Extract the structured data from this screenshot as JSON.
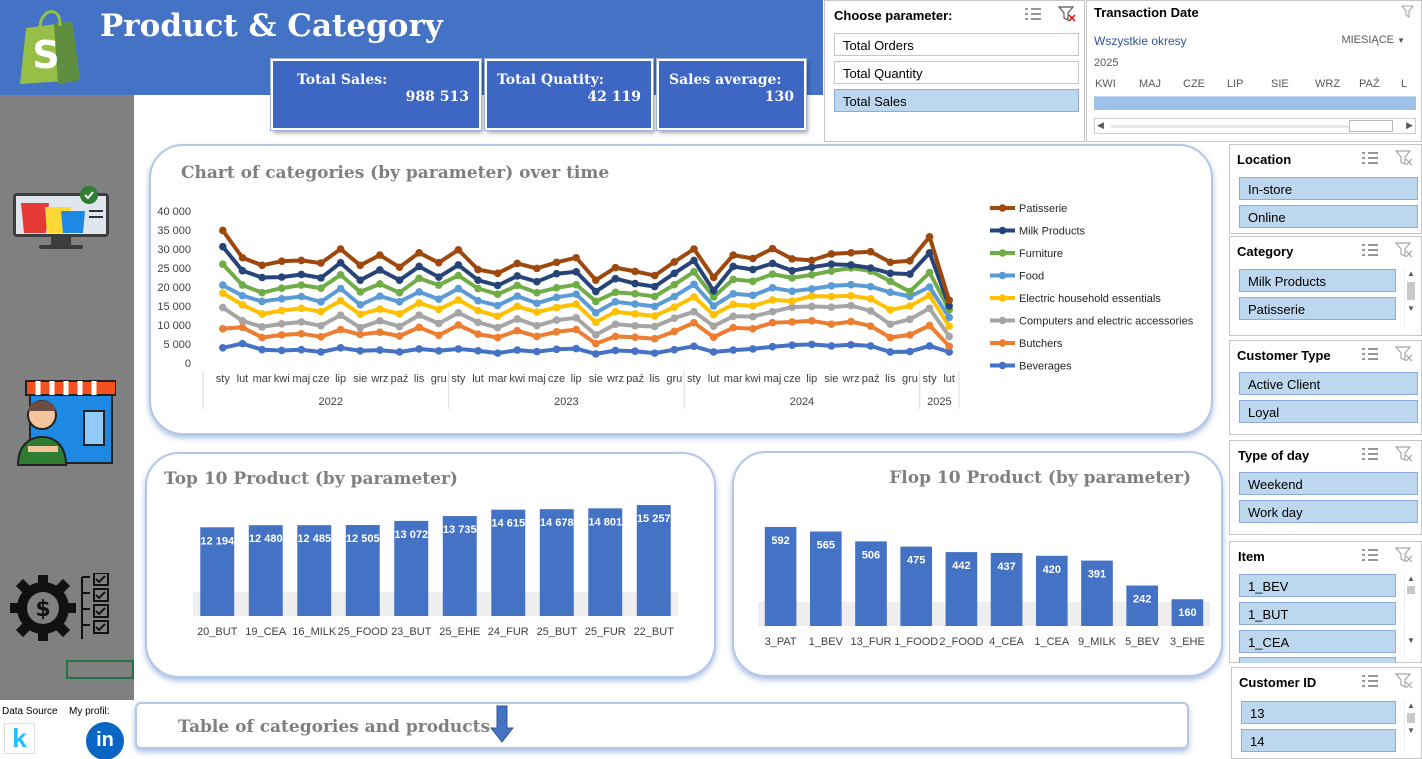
{
  "header": {
    "title": "Product & Category",
    "kpis": [
      {
        "label": "Total Sales:",
        "value": "988 513"
      },
      {
        "label": "Total Quatity:",
        "value": "42 119"
      },
      {
        "label": "Sales average:",
        "value": "130"
      }
    ]
  },
  "parameter": {
    "title": "Choose parameter:",
    "options": [
      "Total Orders",
      "Total Quantity",
      "Total Sales"
    ],
    "selected": "Total Sales"
  },
  "timeline": {
    "title": "Transaction Date",
    "period_label": "Wszystkie okresy",
    "unit": "MIESIĄCE",
    "year": "2025",
    "months": [
      "KWI",
      "MAJ",
      "CZE",
      "LIP",
      "SIE",
      "WRZ",
      "PAŹ",
      "L"
    ]
  },
  "slicers": {
    "location": {
      "title": "Location",
      "items": [
        "In-store",
        "Online"
      ]
    },
    "category": {
      "title": "Category",
      "items": [
        "Milk Products",
        "Patisserie"
      ]
    },
    "customer_type": {
      "title": "Customer Type",
      "items": [
        "Active Client",
        "Loyal"
      ]
    },
    "type_of_day": {
      "title": "Type of day",
      "items": [
        "Weekend",
        "Work day"
      ]
    },
    "item": {
      "title": "Item",
      "items": [
        "1_BEV",
        "1_BUT",
        "1_CEA"
      ]
    },
    "customer_id": {
      "title": "Customer ID",
      "items": [
        "13",
        "14"
      ]
    }
  },
  "sidebar": {
    "data_source_label": "Data Source",
    "profile_label": "My profil:",
    "kaggle_letter": "k",
    "linkedin_letters": "in"
  },
  "colors": {
    "accent": "#4472c4",
    "bar": "#4472c4",
    "sidebar": "#808080",
    "slicer_item": "#bdd7ee"
  },
  "chart_data": [
    {
      "type": "line",
      "title": "Chart of categories (by parameter) over time",
      "y_ticks": [
        "0",
        "5 000",
        "10 000",
        "15 000",
        "20 000",
        "25 000",
        "30 000",
        "35 000",
        "40 000"
      ],
      "ylim": [
        0,
        40000
      ],
      "month_labels": [
        "sty",
        "lut",
        "mar",
        "kwi",
        "maj",
        "cze",
        "lip",
        "sie",
        "wrz",
        "paź",
        "lis",
        "gru"
      ],
      "years": [
        "2022",
        "2023",
        "2024",
        "2025"
      ],
      "legend_position": "right",
      "series": [
        {
          "name": "Patisserie",
          "color": "#9e480e",
          "values": [
            34900,
            27700,
            25700,
            26800,
            27000,
            26300,
            30000,
            25700,
            28400,
            25200,
            29000,
            26400,
            29800,
            24600,
            23600,
            26200,
            24900,
            26500,
            27700,
            21800,
            25100,
            24100,
            23000,
            26600,
            30000,
            22500,
            28400,
            27500,
            30100,
            27400,
            27000,
            28700,
            29000,
            29300,
            26500,
            26900,
            33200,
            16500
          ]
        },
        {
          "name": "Milk Products",
          "color": "#264478",
          "values": [
            30600,
            24300,
            22500,
            22600,
            23300,
            22400,
            26400,
            21800,
            24500,
            21800,
            25400,
            22600,
            25800,
            21800,
            20400,
            22900,
            21400,
            23500,
            24000,
            18800,
            22200,
            20900,
            20100,
            23600,
            27000,
            19000,
            25400,
            24600,
            26200,
            24300,
            25200,
            26000,
            25800,
            25000,
            23600,
            23400,
            29000,
            15000
          ]
        },
        {
          "name": "Furniture",
          "color": "#70ad47",
          "values": [
            26000,
            20500,
            18500,
            19700,
            20500,
            19700,
            23200,
            18700,
            20800,
            18500,
            22300,
            20500,
            23000,
            19600,
            18100,
            20400,
            18500,
            19800,
            20600,
            16200,
            18600,
            18200,
            17500,
            20600,
            24000,
            17400,
            22000,
            21500,
            23400,
            22400,
            23200,
            24200,
            25000,
            24200,
            21500,
            18800,
            23800,
            14000
          ]
        },
        {
          "name": "Food",
          "color": "#5b9bd5",
          "values": [
            20500,
            17700,
            16200,
            16900,
            17500,
            16100,
            19600,
            15300,
            17600,
            16100,
            18700,
            16800,
            19600,
            16400,
            15100,
            17600,
            15700,
            17300,
            18100,
            13200,
            16100,
            15500,
            14900,
            17500,
            20700,
            15000,
            18200,
            17800,
            19800,
            18900,
            19500,
            20300,
            20600,
            20100,
            18600,
            17500,
            20000,
            12000
          ]
        },
        {
          "name": "Electric household essentials",
          "color": "#ffc000",
          "values": [
            18400,
            15300,
            12900,
            13800,
            14400,
            13500,
            16400,
            12800,
            14200,
            12900,
            15800,
            14100,
            16600,
            13800,
            12300,
            14900,
            13400,
            14600,
            15500,
            10700,
            13500,
            12900,
            12400,
            14700,
            17400,
            12700,
            15400,
            15000,
            16600,
            16300,
            17600,
            17500,
            17700,
            16900,
            14000,
            15000,
            17800,
            9700
          ]
        },
        {
          "name": "Computers and electric accessories",
          "color": "#a5a5a5",
          "values": [
            14600,
            11100,
            9500,
            10300,
            10800,
            9800,
            12600,
            9300,
            11100,
            9600,
            12600,
            10400,
            13200,
            10700,
            9300,
            11600,
            9800,
            11300,
            11900,
            7400,
            10200,
            9800,
            9600,
            11800,
            13500,
            9700,
            12300,
            12200,
            13500,
            14700,
            14900,
            14700,
            15100,
            13700,
            10200,
            11500,
            14400,
            7000
          ]
        },
        {
          "name": "Butchers",
          "color": "#ed7d31",
          "values": [
            9000,
            9400,
            6700,
            7400,
            7700,
            6900,
            8800,
            7500,
            8100,
            7100,
            9400,
            7300,
            10000,
            7600,
            6700,
            8500,
            7000,
            8200,
            8800,
            5100,
            7000,
            6800,
            6400,
            8300,
            10600,
            6800,
            9300,
            9000,
            10600,
            10800,
            11100,
            10200,
            10900,
            9700,
            6700,
            7400,
            9900,
            4400
          ]
        },
        {
          "name": "Beverages",
          "color": "#4472c4",
          "values": [
            4000,
            5100,
            3500,
            3300,
            3500,
            2900,
            4000,
            3200,
            3400,
            2900,
            3700,
            3200,
            3700,
            3200,
            2600,
            3400,
            3000,
            3600,
            3800,
            2400,
            3300,
            3100,
            2600,
            3500,
            4400,
            2900,
            3400,
            3700,
            4300,
            4700,
            4900,
            4500,
            4800,
            4500,
            2900,
            3000,
            4500,
            2900
          ]
        }
      ]
    },
    {
      "type": "bar",
      "title": "Top 10 Product (by parameter)",
      "categories": [
        "20_BUT",
        "19_CEA",
        "16_MILK",
        "25_FOOD",
        "23_BUT",
        "25_EHE",
        "24_FUR",
        "25_BUT",
        "25_FUR",
        "22_BUT"
      ],
      "values": [
        12194,
        12480,
        12485,
        12505,
        13072,
        13735,
        14615,
        14678,
        14801,
        15257
      ],
      "value_labels": [
        "12 194",
        "12 480",
        "12 485",
        "12 505",
        "13 072",
        "13 735",
        "14 615",
        "14 678",
        "14 801",
        "15 257"
      ],
      "data_label_position": "inside_top"
    },
    {
      "type": "bar",
      "title": "Flop 10 Product (by parameter)",
      "categories": [
        "3_PAT",
        "1_BEV",
        "13_FUR",
        "1_FOOD",
        "2_FOOD",
        "4_CEA",
        "1_CEA",
        "9_MILK",
        "5_BEV",
        "3_EHE"
      ],
      "values": [
        592,
        565,
        506,
        475,
        442,
        437,
        420,
        391,
        242,
        160
      ],
      "value_labels": [
        "592",
        "565",
        "506",
        "475",
        "442",
        "437",
        "420",
        "391",
        "242",
        "160"
      ],
      "data_label_position": "inside_top"
    }
  ],
  "table_section": {
    "title": "Table of categories and products"
  }
}
